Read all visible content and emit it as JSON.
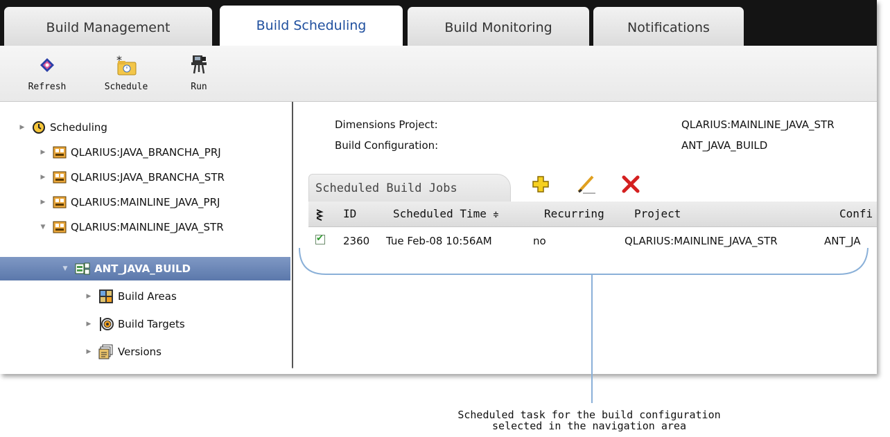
{
  "tabs": [
    {
      "label": "Build Management"
    },
    {
      "label": "Build Scheduling"
    },
    {
      "label": "Build Monitoring"
    },
    {
      "label": "Notifications"
    }
  ],
  "toolbar": {
    "refresh_label": "Refresh",
    "schedule_label": "Schedule",
    "run_label": "Run"
  },
  "nav": {
    "root": "Scheduling",
    "items": [
      {
        "label": "QLARIUS:JAVA_BRANCHA_PRJ"
      },
      {
        "label": "QLARIUS:JAVA_BRANCHA_STR"
      },
      {
        "label": "QLARIUS:MAINLINE_JAVA_PRJ"
      },
      {
        "label": "QLARIUS:MAINLINE_JAVA_STR"
      },
      {
        "label": "ANT_JAVA_BUILD"
      },
      {
        "label": "Build Areas"
      },
      {
        "label": "Build Targets"
      },
      {
        "label": "Versions"
      }
    ]
  },
  "details": {
    "project_label": "Dimensions Project:",
    "project_value": "QLARIUS:MAINLINE_JAVA_STR",
    "config_label": "Build Configuration:",
    "config_value": "ANT_JAVA_BUILD"
  },
  "jobs": {
    "tab_label": "Scheduled Build Jobs",
    "columns": {
      "id": "ID",
      "time": "Scheduled Time",
      "recurring": "Recurring",
      "project": "Project",
      "config": "Confi"
    },
    "rows": [
      {
        "id": "2360",
        "time": "Tue Feb-08 10:56AM",
        "recurring": "no",
        "project": "QLARIUS:MAINLINE_JAVA_STR",
        "config": "ANT_JA"
      }
    ]
  },
  "caption": {
    "line1": "Scheduled task for the build configuration",
    "line2": "selected in the navigation area"
  },
  "colors": {
    "tab_active_text": "#1f4f9e",
    "selection": "#5b78ab",
    "callout": "#8ab0d8"
  }
}
